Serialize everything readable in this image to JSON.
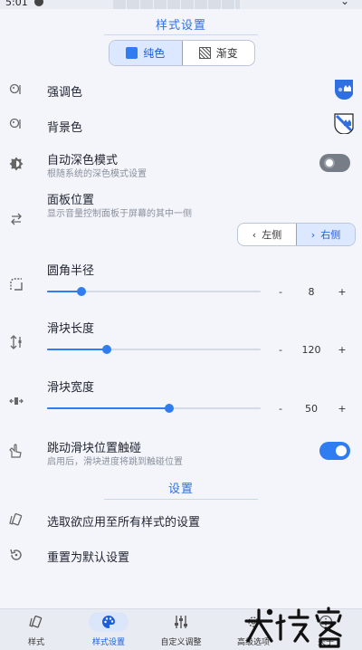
{
  "status": {
    "time": "5:01"
  },
  "header": {
    "title": "样式设置"
  },
  "style_mode": {
    "solid_label": "纯色",
    "gradient_label": "渐变"
  },
  "accent": {
    "title": "强调色",
    "color": "#2f6fe0"
  },
  "background": {
    "title": "背景色",
    "color": "#2f6fe0"
  },
  "auto_dark": {
    "title": "自动深色模式",
    "subtitle": "根随系统的深色模式设置",
    "enabled": false
  },
  "panel_position": {
    "title": "面板位置",
    "subtitle": "显示音量控制面板于屏幕的其中一侧",
    "left_label": "左侧",
    "right_label": "右侧",
    "selected": "右侧"
  },
  "corner_radius": {
    "title": "圆角半径",
    "value": "8",
    "fraction": 0.16
  },
  "slider_length": {
    "title": "滑块长度",
    "value": "120",
    "fraction": 0.28
  },
  "slider_width": {
    "title": "滑块宽度",
    "value": "50",
    "fraction": 0.57
  },
  "jump_touch": {
    "title": "跳动滑块位置触碰",
    "subtitle": "启用后，滑块进度将跳到触碰位置",
    "enabled": true
  },
  "settings": {
    "title": "设置",
    "apply_all": "选取欲应用至所有样式的设置",
    "reset": "重置为默认设置"
  },
  "stepper": {
    "minus": "-",
    "plus": "+"
  },
  "nav": [
    {
      "label": "样式"
    },
    {
      "label": "样式设置"
    },
    {
      "label": "自定义调整"
    },
    {
      "label": "高级选项"
    },
    {
      "label": "关于"
    }
  ],
  "watermark": {
    "text": "大玩客"
  },
  "colors": {
    "accent": "#2f7df0",
    "toggle_off": "#777d87"
  }
}
